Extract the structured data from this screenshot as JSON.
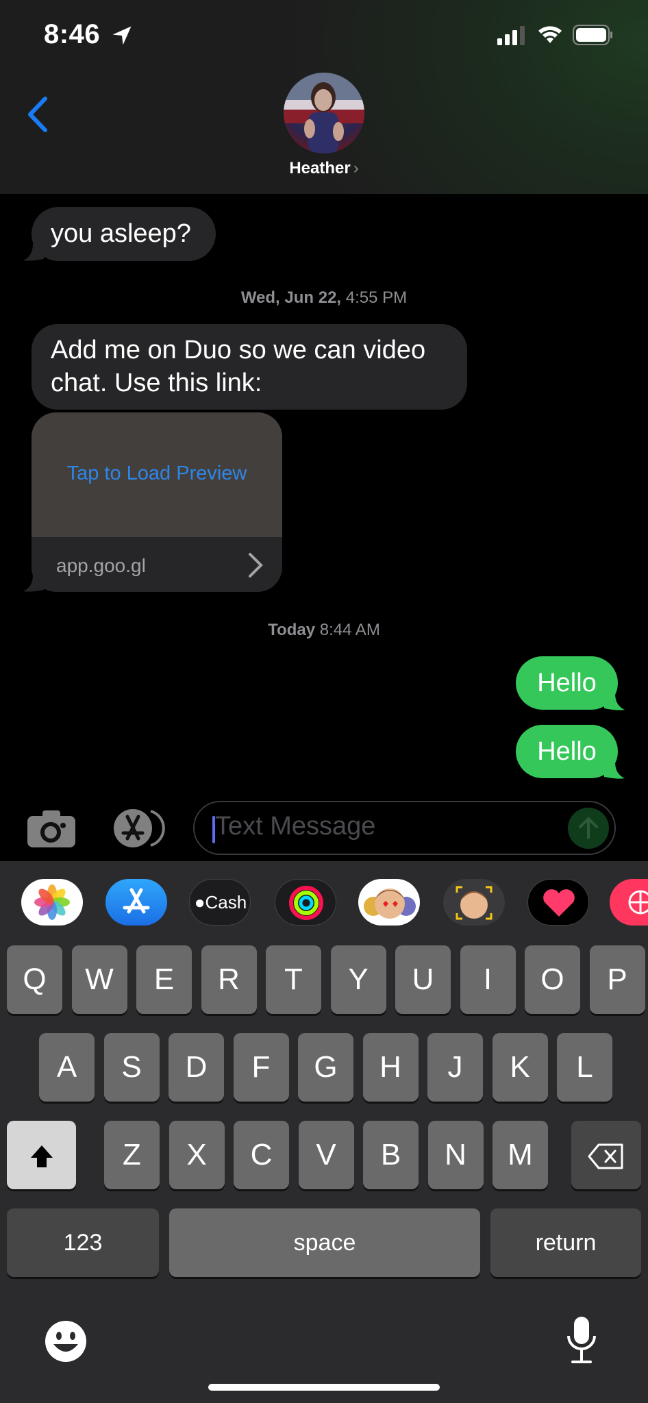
{
  "status_bar": {
    "time": "8:46",
    "location_icon": "location-arrow-icon",
    "signal_icon": "cellular-signal-icon",
    "wifi_icon": "wifi-icon",
    "battery_icon": "battery-icon"
  },
  "header": {
    "back_icon": "chevron-left-icon",
    "contact_name": "Heather",
    "contact_chevron": "›",
    "accent_color": "#1a7cf5"
  },
  "messages": [
    {
      "direction": "received",
      "text": "you asleep?"
    },
    {
      "type": "timestamp",
      "day": "Wed, Jun 22,",
      "time": "4:55 PM"
    },
    {
      "direction": "received",
      "text": "Add me on Duo so we can video chat. Use this link:"
    },
    {
      "direction": "received",
      "type": "link",
      "preview_label": "Tap to Load Preview",
      "domain": "app.goo.gl"
    },
    {
      "type": "timestamp",
      "day": "Today",
      "time": "8:44 AM"
    },
    {
      "direction": "sent",
      "text": "Hello"
    },
    {
      "direction": "sent",
      "text": "Hello"
    }
  ],
  "colors": {
    "sent_bubble": "#35c759",
    "received_bubble": "#262628",
    "link_blue": "#2e86e8"
  },
  "input_bar": {
    "camera_icon": "camera-icon",
    "apps_icon": "app-store-icon",
    "placeholder": "Text Message",
    "send_icon": "arrow-up-icon"
  },
  "app_strip": [
    {
      "name": "Photos",
      "icon": "photos-icon"
    },
    {
      "name": "App Store",
      "icon": "app-store-icon"
    },
    {
      "name": "Cash",
      "label": "Cash",
      "icon": "apple-cash-icon"
    },
    {
      "name": "Activity",
      "icon": "activity-rings-icon"
    },
    {
      "name": "Memoji Stickers",
      "icon": "memoji-stickers-icon"
    },
    {
      "name": "Animoji",
      "icon": "animoji-icon"
    },
    {
      "name": "Digital Touch",
      "icon": "heart-icon"
    },
    {
      "name": "Images",
      "icon": "globe-search-icon"
    }
  ],
  "keyboard": {
    "row1": [
      "Q",
      "W",
      "E",
      "R",
      "T",
      "Y",
      "U",
      "I",
      "O",
      "P"
    ],
    "row2": [
      "A",
      "S",
      "D",
      "F",
      "G",
      "H",
      "J",
      "K",
      "L"
    ],
    "row3": [
      "Z",
      "X",
      "C",
      "V",
      "B",
      "N",
      "M"
    ],
    "shift_icon": "shift-arrow-icon",
    "delete_icon": "delete-backspace-icon",
    "numbers_label": "123",
    "space_label": "space",
    "return_label": "return",
    "emoji_icon": "emoji-face-icon",
    "mic_icon": "microphone-icon"
  }
}
